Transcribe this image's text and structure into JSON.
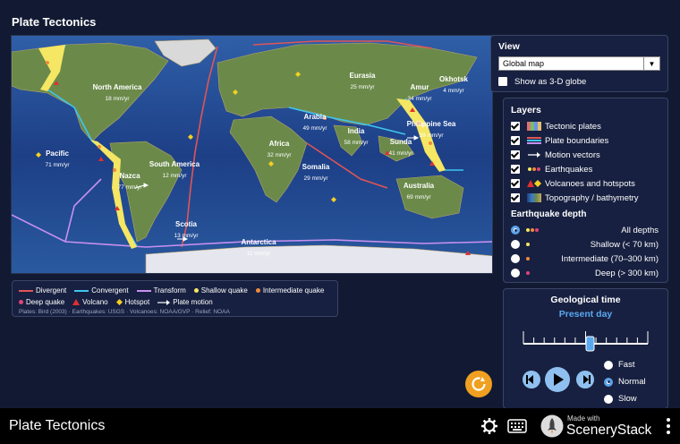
{
  "app": {
    "title": "Plate Tectonics",
    "footer_title": "Plate Tectonics"
  },
  "map": {
    "plates": [
      {
        "name": "North America",
        "rate": "18 mm/yr"
      },
      {
        "name": "Eurasia",
        "rate": "25 mm/yr"
      },
      {
        "name": "Okhotsk",
        "rate": "4 mm/yr"
      },
      {
        "name": "Amur",
        "rate": "34 mm/yr"
      },
      {
        "name": "Arabia",
        "rate": "49 mm/yr"
      },
      {
        "name": "Philippine Sea",
        "rate": "39 mm/yr"
      },
      {
        "name": "India",
        "rate": "58 mm/yr"
      },
      {
        "name": "Africa",
        "rate": "32 mm/yr"
      },
      {
        "name": "Sunda",
        "rate": "41 mm/yr"
      },
      {
        "name": "Pacific",
        "rate": "71 mm/yr"
      },
      {
        "name": "South America",
        "rate": "12 mm/yr"
      },
      {
        "name": "Nazca",
        "rate": "77 mm/yr"
      },
      {
        "name": "Somalia",
        "rate": "29 mm/yr"
      },
      {
        "name": "Australia",
        "rate": "69 mm/yr"
      },
      {
        "name": "Scotia",
        "rate": "13 mm/yr"
      },
      {
        "name": "Antarctica",
        "rate": "11 mm/yr"
      }
    ]
  },
  "legend": {
    "items": [
      {
        "label": "Divergent",
        "color": "#e05555",
        "kind": "line"
      },
      {
        "label": "Convergent",
        "color": "#3ec6f0",
        "kind": "line"
      },
      {
        "label": "Transform",
        "color": "#c890f0",
        "kind": "line"
      },
      {
        "label": "Shallow quake",
        "color": "#f5e663",
        "kind": "dot"
      },
      {
        "label": "Intermediate quake",
        "color": "#f08a3c",
        "kind": "dot"
      },
      {
        "label": "Deep quake",
        "color": "#e0447a",
        "kind": "dot"
      },
      {
        "label": "Volcano",
        "color": "#e03030",
        "kind": "triangle"
      },
      {
        "label": "Hotspot",
        "color": "#f5d020",
        "kind": "diamond"
      },
      {
        "label": "Plate motion",
        "color": "#ffffff",
        "kind": "arrow"
      }
    ],
    "credits": "Plates: Bird (2003) · Earthquakes: USGS · Volcanoes: NOAA/GVP · Relief: NOAA"
  },
  "view": {
    "title": "View",
    "selected": "Global map",
    "globe_label": "Show as 3-D globe",
    "globe_checked": false
  },
  "layers": {
    "title": "Layers",
    "items": [
      {
        "label": "Tectonic plates",
        "checked": true
      },
      {
        "label": "Plate boundaries",
        "checked": true
      },
      {
        "label": "Motion vectors",
        "checked": true
      },
      {
        "label": "Earthquakes",
        "checked": true
      },
      {
        "label": "Volcanoes and hotspots",
        "checked": true
      },
      {
        "label": "Topography / bathymetry",
        "checked": true
      }
    ],
    "depth_title": "Earthquake depth",
    "depth": [
      {
        "label": "All depths",
        "selected": true
      },
      {
        "label": "Shallow (< 70 km)",
        "selected": false
      },
      {
        "label": "Intermediate (70–300 km)",
        "selected": false
      },
      {
        "label": "Deep (> 300 km)",
        "selected": false
      }
    ]
  },
  "time": {
    "title": "Geological time",
    "current": "Present day",
    "slider_fraction": 0.5,
    "speeds": [
      {
        "label": "Fast",
        "selected": false
      },
      {
        "label": "Normal",
        "selected": true
      },
      {
        "label": "Slow",
        "selected": false
      }
    ]
  },
  "footer": {
    "made_with": "Made with",
    "brand": "ScenerySt ack"
  }
}
